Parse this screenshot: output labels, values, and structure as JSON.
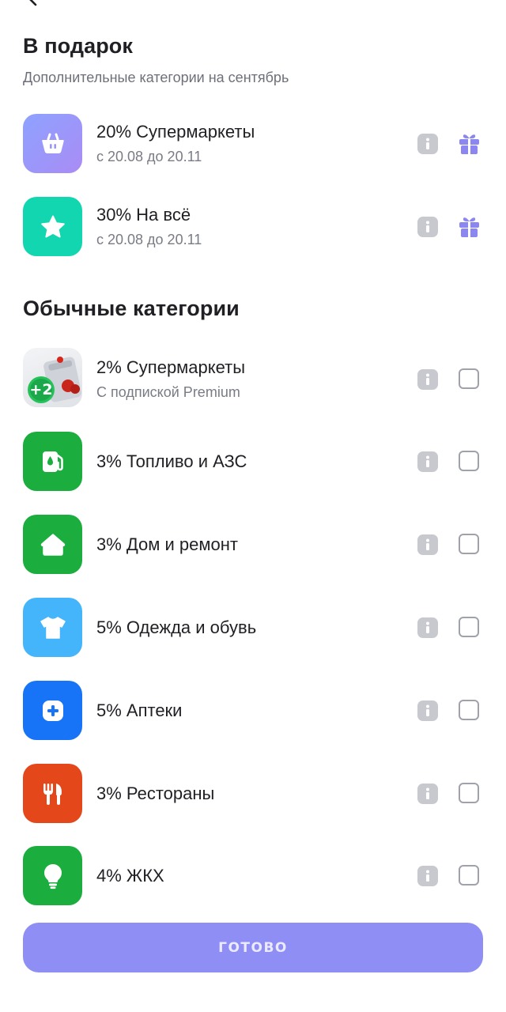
{
  "colors": {
    "accent": "#8f8ef5",
    "gift_icon": "#8b86f0",
    "green": "#1bae3e",
    "teal": "#12d6b0",
    "sky": "#45b5fb",
    "blue": "#1874f7",
    "orange": "#e4481a"
  },
  "gifts": {
    "title": "В подарок",
    "subtitle": "Дополнительные категории на сентябрь",
    "items": [
      {
        "label": "20% Супермаркеты",
        "sub": "с 20.08 до 20.11",
        "icon": "basket-icon"
      },
      {
        "label": "30% На всё",
        "sub": "с 20.08 до 20.11",
        "icon": "star-icon"
      }
    ]
  },
  "regular": {
    "title": "Обычные категории",
    "items": [
      {
        "label": "2% Супермаркеты",
        "sub": "С подпиской Premium",
        "icon": "supermarket-promo-icon",
        "badge": "+2",
        "checked": false
      },
      {
        "label": "3% Топливо и АЗС",
        "icon": "fuel-icon",
        "checked": false
      },
      {
        "label": "3% Дом и ремонт",
        "icon": "house-icon",
        "checked": false
      },
      {
        "label": "5% Одежда и обувь",
        "icon": "tshirt-icon",
        "checked": false
      },
      {
        "label": "5% Аптеки",
        "icon": "pharmacy-cross-icon",
        "checked": false
      },
      {
        "label": "3% Рестораны",
        "icon": "cutlery-icon",
        "checked": false
      },
      {
        "label": "4% ЖКХ",
        "icon": "lightbulb-icon",
        "checked": false
      }
    ]
  },
  "done_button": {
    "label": "ГОТОВО"
  }
}
